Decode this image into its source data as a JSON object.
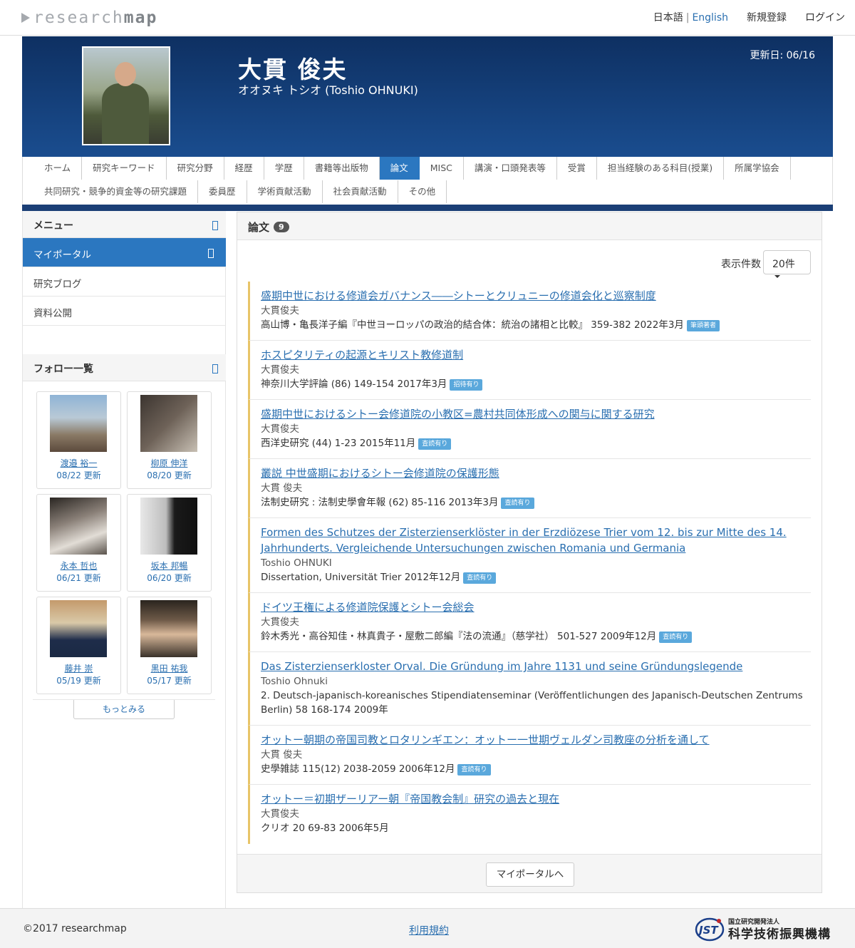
{
  "topbar": {
    "logo_light": "research",
    "logo_bold": "map",
    "lang_ja": "日本語",
    "lang_sep": "|",
    "lang_en": "English",
    "signup": "新規登録",
    "login": "ログイン"
  },
  "profile": {
    "name": "大貫 俊夫",
    "kana": "オオヌキ トシオ (Toshio OHNUKI)",
    "updated": "更新日: 06/16"
  },
  "tabs": {
    "row1": [
      "ホーム",
      "研究キーワード",
      "研究分野",
      "経歴",
      "学歴",
      "書籍等出版物",
      "論文",
      "MISC",
      "講演・口頭発表等",
      "受賞",
      "担当経験のある科目(授業)",
      "所属学協会"
    ],
    "row2": [
      "共同研究・競争的資金等の研究課題",
      "委員歴",
      "学術貢献活動",
      "社会貢献活動",
      "その他"
    ],
    "active": "論文"
  },
  "sidebar": {
    "menu_title": "メニュー",
    "items": [
      "マイポータル",
      "研究ブログ",
      "資料公開"
    ],
    "follow_title": "フォロー一覧",
    "follows": [
      {
        "name": "渡邉 裕一",
        "date": "08/22 更新"
      },
      {
        "name": "柳原 伸洋",
        "date": "08/20 更新"
      },
      {
        "name": "永本 哲也",
        "date": "06/21 更新"
      },
      {
        "name": "坂本 邦暢",
        "date": "06/20 更新"
      },
      {
        "name": "藤井 崇",
        "date": "05/19 更新"
      },
      {
        "name": "黒田 祐我",
        "date": "05/17 更新"
      }
    ],
    "more": "もっとみる"
  },
  "main": {
    "title": "論文",
    "count": "9",
    "count_label": "表示件数",
    "count_value": "20件",
    "entries": [
      {
        "title": "盛期中世における修道会ガバナンス――シトーとクリュニーの修道会化と巡察制度",
        "author": "大貫俊夫",
        "venue": "高山博・亀長洋子編『中世ヨーロッパの政治的結合体：統治の諸相と比較』 359-382 2022年3月",
        "tag": "筆頭著者"
      },
      {
        "title": "ホスピタリティの起源とキリスト教修道制",
        "author": "大貫俊夫",
        "venue": "神奈川大学評論 (86) 149-154 2017年3月",
        "tag": "招待有り"
      },
      {
        "title": "盛期中世におけるシトー会修道院の小教区=農村共同体形成への関与に関する研究",
        "author": "大貫俊夫",
        "venue": "西洋史研究 (44) 1-23 2015年11月",
        "tag": "査読有り"
      },
      {
        "title": "叢説 中世盛期におけるシトー会修道院の保護形態",
        "author": "大貫 俊夫",
        "venue": "法制史研究 : 法制史學會年報 (62) 85-116 2013年3月",
        "tag": "査読有り"
      },
      {
        "title": "Formen des Schutzes der Zisterzienserklöster in der Erzdiözese Trier vom 12. bis zur Mitte des 14. Jahrhunderts. Vergleichende Untersuchungen zwischen Romania und Germania",
        "author": "Toshio OHNUKI",
        "venue": "Dissertation, Universität Trier 2012年12月",
        "tag": "査読有り"
      },
      {
        "title": "ドイツ王権による修道院保護とシトー会総会",
        "author": "大貫俊夫",
        "venue": "鈴木秀光・高谷知佳・林真貴子・屋敷二郎編『法の流通』（慈学社） 501-527 2009年12月",
        "tag": "査読有り"
      },
      {
        "title": "Das Zisterzienserkloster Orval. Die Gründung im Jahre 1131 und seine Gründungslegende",
        "author": "Toshio Ohnuki",
        "venue": "2. Deutsch-japanisch-koreanisches Stipendiatenseminar (Veröffentlichungen des Japanisch-Deutschen Zentrums Berlin) 58 168-174 2009年",
        "tag": ""
      },
      {
        "title": "オットー朝期の帝国司教とロタリンギエン：オットー一世期ヴェルダン司教座の分析を通して",
        "author": "大貫 俊夫",
        "venue": "史學雑誌 115(12) 2038-2059 2006年12月",
        "tag": "査読有り"
      },
      {
        "title": "オットー＝初期ザーリアー朝『帝国教会制』研究の過去と現在",
        "author": "大貫俊夫",
        "venue": "クリオ 20 69-83 2006年5月",
        "tag": ""
      }
    ],
    "portal_button": "マイポータルへ"
  },
  "footer": {
    "copyright": "2017 researchmap",
    "terms": "利用規約",
    "jst_small": "国立研究開発法人",
    "jst_big": "科学技術振興機構",
    "jst_mark": "JST"
  }
}
